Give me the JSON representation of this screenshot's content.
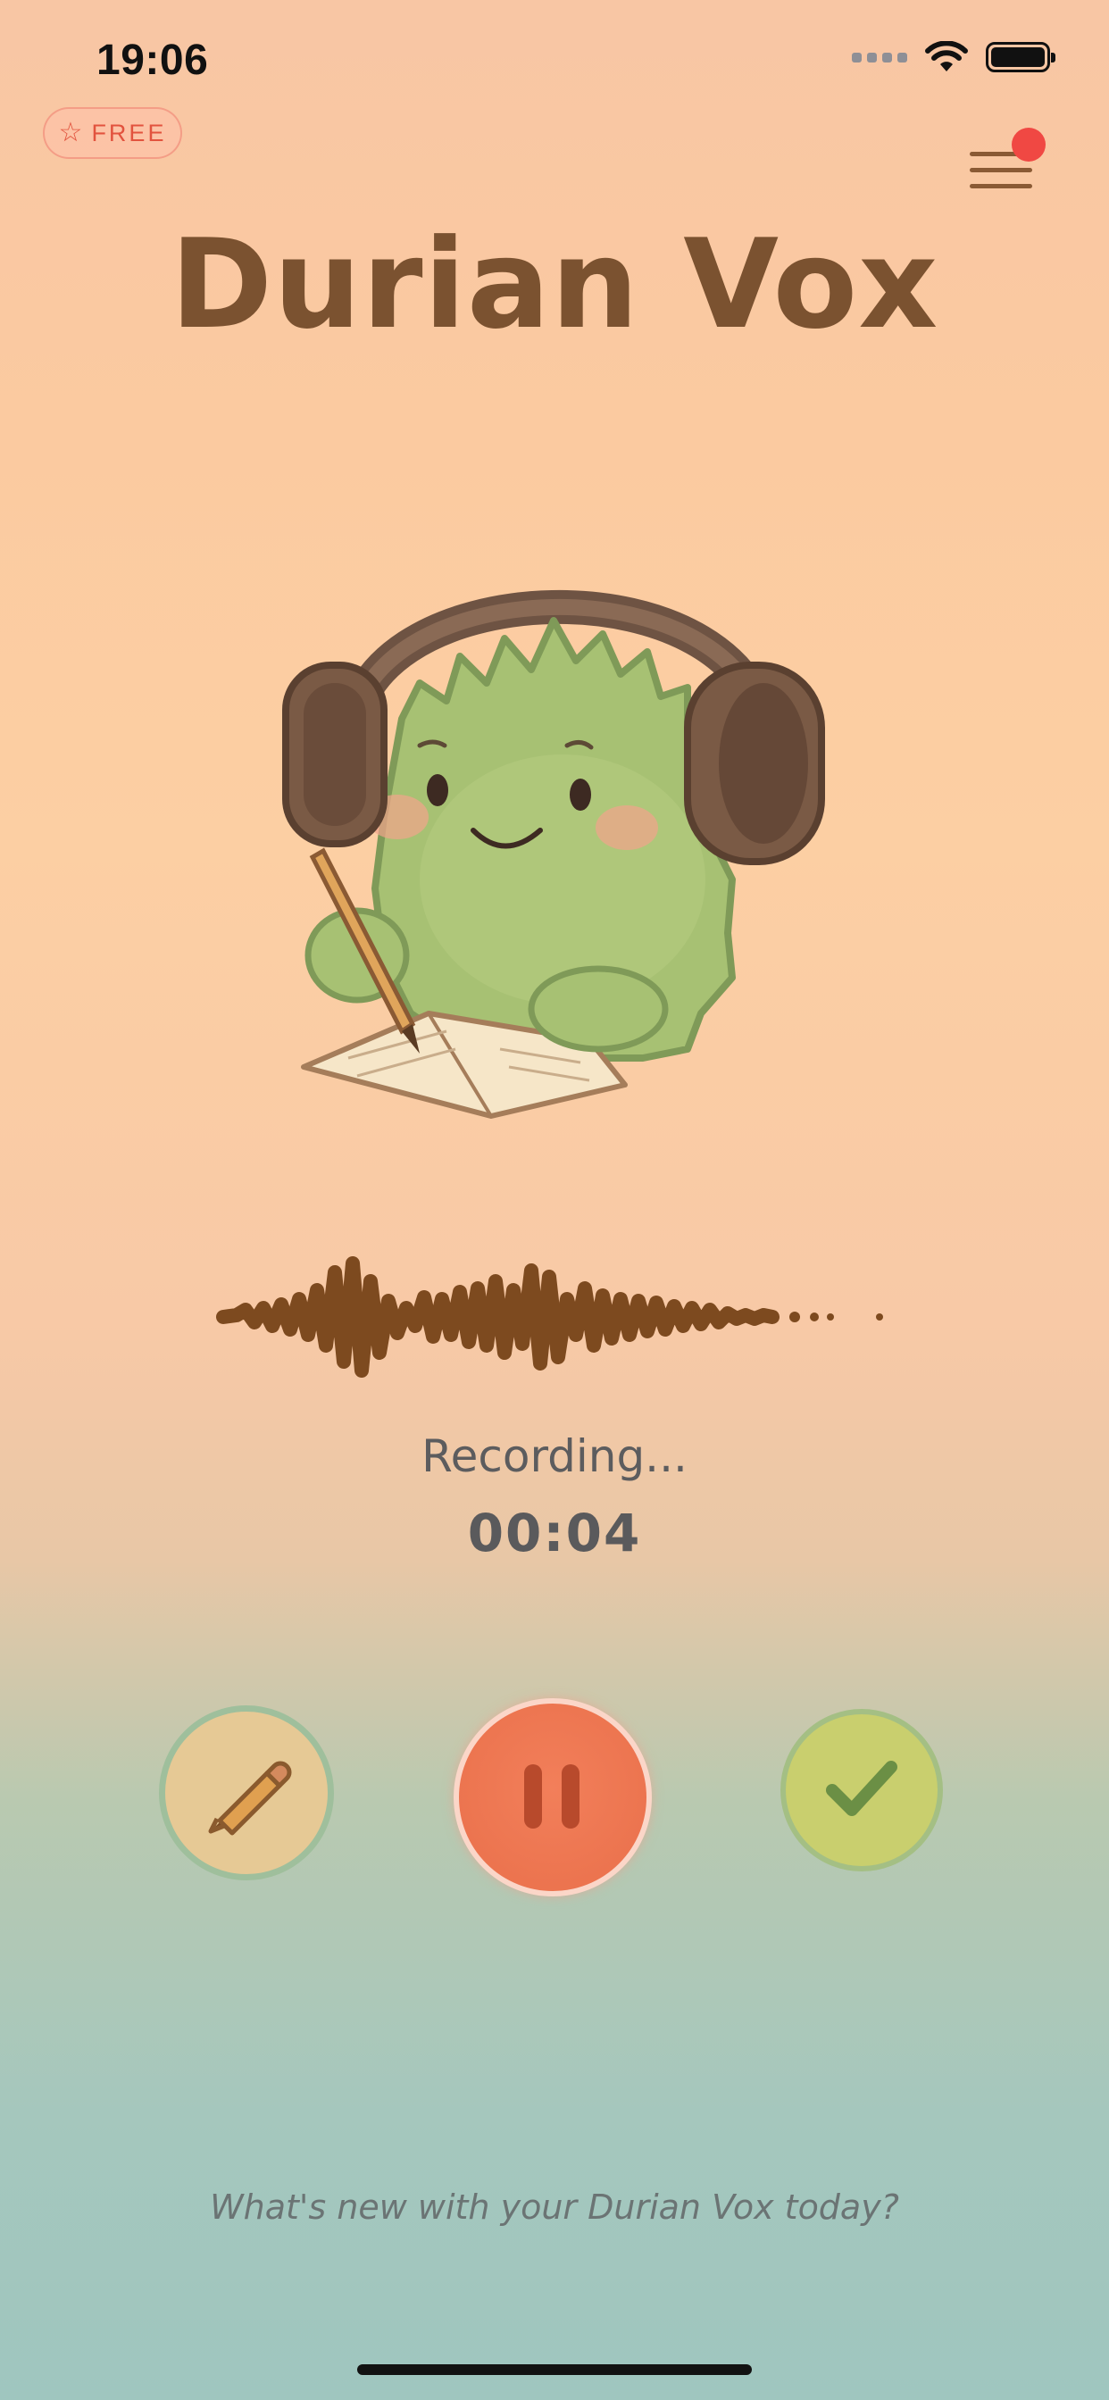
{
  "status_bar": {
    "time": "19:06",
    "icons": [
      "signal-icon",
      "wifi-icon",
      "battery-icon"
    ]
  },
  "badge": {
    "icon": "star-icon",
    "label": "FREE"
  },
  "menu": {
    "icon": "menu-icon",
    "has_notification": true
  },
  "header": {
    "title": "Durian Vox"
  },
  "mascot": {
    "icon": "durian-mascot-with-headphones"
  },
  "recording": {
    "status": "Recording...",
    "timer": "00:04"
  },
  "controls": {
    "edit_icon": "pencil-icon",
    "pause_icon": "pause-icon",
    "done_icon": "checkmark-icon"
  },
  "prompt": {
    "text": "What's new with your Durian Vox today?"
  },
  "colors": {
    "accent_orange": "#ec744f",
    "title_brown": "#7b5230",
    "badge_red": "#e2533e",
    "notification_red": "#f04843",
    "done_green": "#c9cf6e",
    "edit_tan": "#e6c995"
  }
}
